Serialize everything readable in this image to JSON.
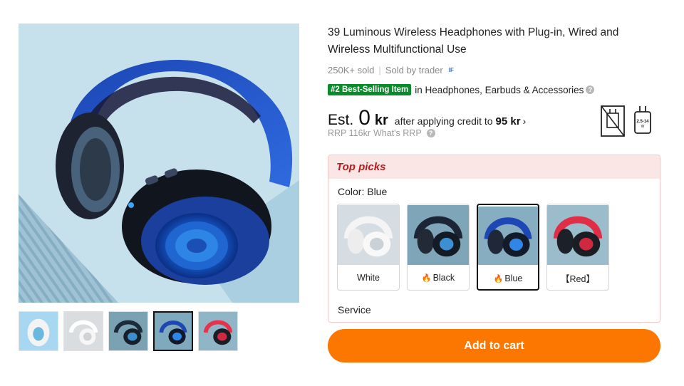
{
  "product": {
    "title": "39 Luminous Wireless Headphones with Plug-in, Wired and Wireless Multifunctional Use",
    "sold": "250K+ sold",
    "separator": "|",
    "seller": "Sold by trader",
    "seller_badge": "IF",
    "bestseller_badge": "#2 Best-Selling Item",
    "bestseller_category": "in Headphones, Earbuds & Accessories",
    "info_icon": "?"
  },
  "price": {
    "est_label": "Est.",
    "est_value": "0",
    "est_currency": "kr",
    "credit_text": "after applying credit to",
    "credit_amount": "95 kr",
    "chevron": "›",
    "rrp": "RRP 116kr",
    "whats_rrp": "What's RRP"
  },
  "charger": {
    "watt_label": "2.5-14",
    "watt_unit": "W"
  },
  "top_picks": {
    "header": "Top picks",
    "color_label": "Color: Blue",
    "colors": [
      {
        "label": "White",
        "hot": false,
        "selected": false
      },
      {
        "label": "Black",
        "hot": true,
        "selected": false
      },
      {
        "label": "Blue",
        "hot": true,
        "selected": true
      },
      {
        "label": "【Red】",
        "hot": false,
        "selected": false
      }
    ],
    "flame_icon": "🔥",
    "service_label": "Service"
  },
  "cart": {
    "button_label": "Add to cart"
  },
  "gallery": {
    "selected_thumb": 3,
    "thumb_count": 5
  },
  "colors": {
    "accent_orange": "#fb7701",
    "bestseller_green": "#0a8a2a",
    "top_picks_red": "#b81b1b",
    "top_picks_bg": "#fbe6e6"
  }
}
